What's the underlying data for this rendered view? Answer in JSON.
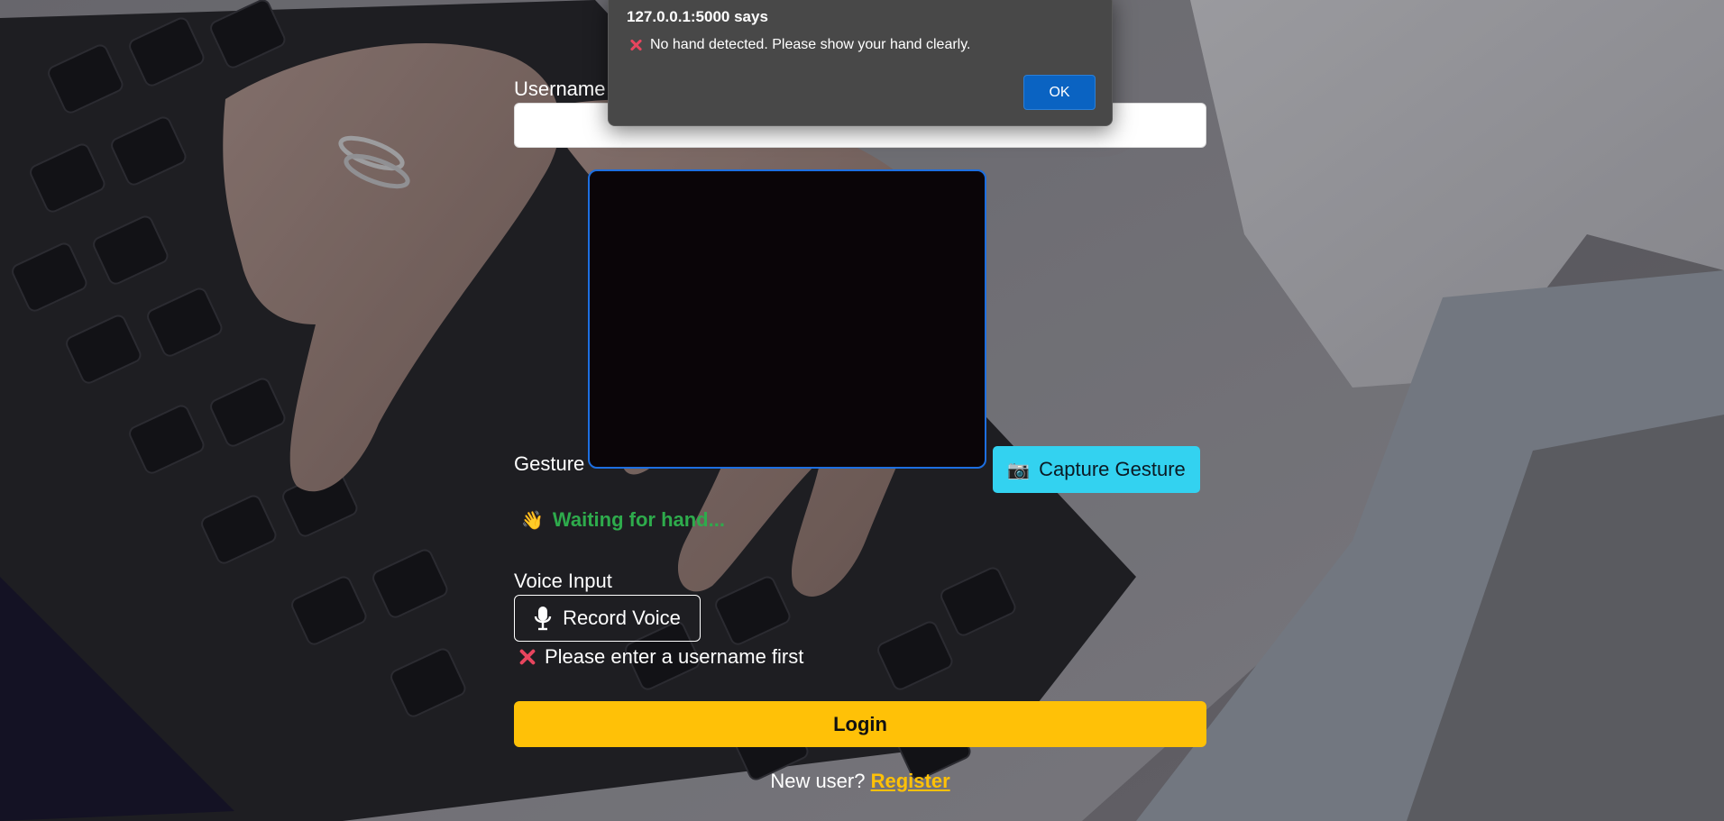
{
  "dialog": {
    "title": "127.0.0.1:5000 says",
    "message": "No hand detected. Please show your hand clearly.",
    "ok_label": "OK"
  },
  "form": {
    "username_label": "Username",
    "username_value": "",
    "gesture_label": "Gesture",
    "capture_icon": "📷",
    "capture_label": "Capture Gesture",
    "gesture_status_icon": "👋",
    "gesture_status": "Waiting for hand...",
    "voice_label": "Voice Input",
    "record_label": "Record Voice",
    "voice_error": "Please enter a username first",
    "login_label": "Login",
    "new_user_text": "New user?",
    "register_label": "Register"
  },
  "colors": {
    "login_button": "#ffc107",
    "capture_button": "#33d2f0",
    "status_waiting": "#2eab4c",
    "error_icon": "#e8455e",
    "dialog_background": "#484848",
    "ok_button": "#0a63c2"
  },
  "icons": {
    "capture": "camera-icon",
    "status": "waving-hand-icon",
    "record": "microphone-icon",
    "error": "x-mark-icon"
  }
}
